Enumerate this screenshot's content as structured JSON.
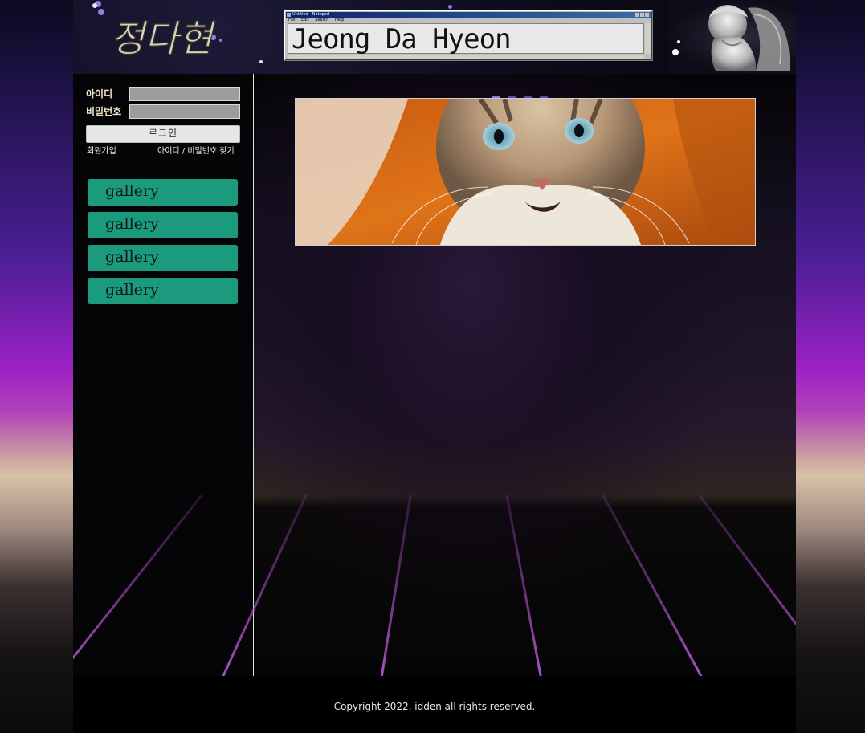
{
  "header": {
    "logo_text": "정다현",
    "notepad": {
      "window_title": "Untitled - Notepad",
      "menu": [
        "File",
        "Edit",
        "Search",
        "Help"
      ],
      "text": "Jeong Da Hyeon"
    }
  },
  "login": {
    "id_label": "아이디",
    "password_label": "비밀번호",
    "id_value": "",
    "password_value": "",
    "login_button": "로그인",
    "signup_link": "회원가입",
    "find_link": "아이디 / 비밀번호 찾기"
  },
  "menu": {
    "items": [
      {
        "label": "gallery"
      },
      {
        "label": "gallery"
      },
      {
        "label": "gallery"
      },
      {
        "label": "gallery"
      }
    ]
  },
  "slider": {
    "slide_count": 4,
    "active_index": 0,
    "image": "cat-photo"
  },
  "footer": {
    "copyright": "Copyright 2022. idden all rights reserved."
  },
  "colors": {
    "menu_button": "#1c9a7d",
    "slider_dot_active": "#8a7ae8",
    "slider_dot": "#5a4ab0",
    "grid_line": "#b04ad0"
  }
}
